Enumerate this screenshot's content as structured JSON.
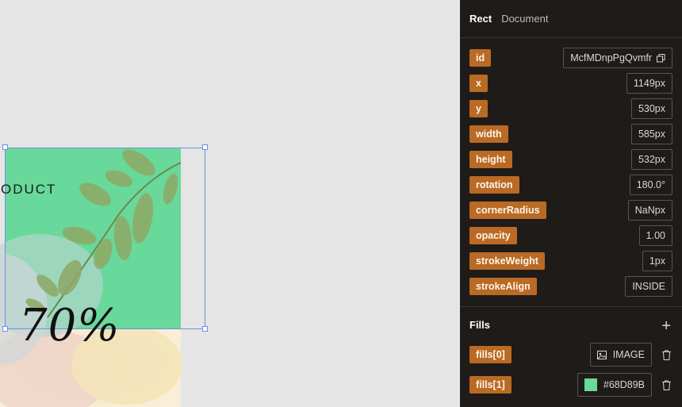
{
  "canvas": {
    "partial_text": "ODUCT",
    "discount_text": "70%"
  },
  "panel": {
    "tabs": [
      {
        "label": "Rect",
        "active": true
      },
      {
        "label": "Document",
        "active": false
      }
    ],
    "properties": [
      {
        "key": "id",
        "value": "McfMDnpPgQvmfr",
        "copy_icon": "copy-icon"
      },
      {
        "key": "x",
        "value": "1149px"
      },
      {
        "key": "y",
        "value": "530px"
      },
      {
        "key": "width",
        "value": "585px"
      },
      {
        "key": "height",
        "value": "532px"
      },
      {
        "key": "rotation",
        "value": "180.0°"
      },
      {
        "key": "cornerRadius",
        "value": "NaNpx"
      },
      {
        "key": "opacity",
        "value": "1.00"
      },
      {
        "key": "strokeWeight",
        "value": "1px"
      },
      {
        "key": "strokeAlign",
        "value": "INSIDE"
      }
    ],
    "fills_section": {
      "title": "Fills",
      "add_label": "+",
      "fills": [
        {
          "key": "fills[0]",
          "value": "IMAGE",
          "icon": "image-icon"
        },
        {
          "key": "fills[1]",
          "value": "#68D89B",
          "swatch_color": "#68D89B"
        }
      ]
    }
  },
  "colors": {
    "accent": "#b96a24",
    "panel_bg": "#1f1b18",
    "canvas_bg": "#e5e5e5",
    "selection": "#6b8fe0",
    "green_fill": "#68D89B"
  }
}
